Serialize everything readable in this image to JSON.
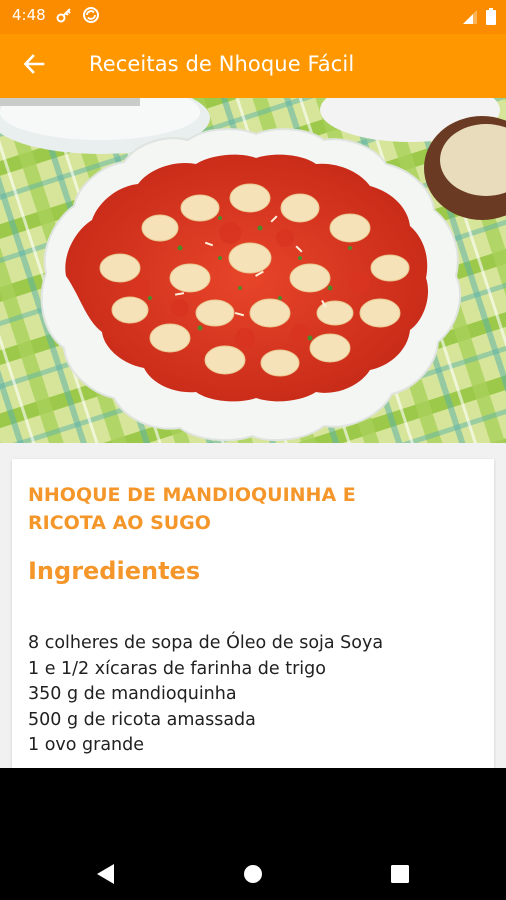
{
  "status_bar": {
    "time": "4:48",
    "icons_left": [
      "key-icon",
      "sync-icon"
    ],
    "icons_right": [
      "signal-icon",
      "battery-icon"
    ]
  },
  "app_bar": {
    "title": "Receitas de Nhoque Fácil",
    "back_icon": "arrow-left-icon",
    "color": "#ff9800"
  },
  "hero_image": {
    "subject": "gnocchi-with-tomato-sauce-photo"
  },
  "recipe": {
    "title_line1": "NHOQUE DE MANDIOQUINHA E",
    "title_line2": "RICOTA AO SUGO",
    "section_heading": "Ingredientes",
    "ingredients": [
      "8 colheres de sopa de Óleo de soja Soya",
      "1 e 1/2 xícaras de farinha de trigo",
      "350 g de mandioquinha",
      "500 g de ricota amassada",
      "1 ovo grande"
    ],
    "accent_color": "#f4962a"
  },
  "nav_bar": {
    "buttons": [
      "back-triangle-icon",
      "home-circle-icon",
      "recents-square-icon"
    ]
  }
}
